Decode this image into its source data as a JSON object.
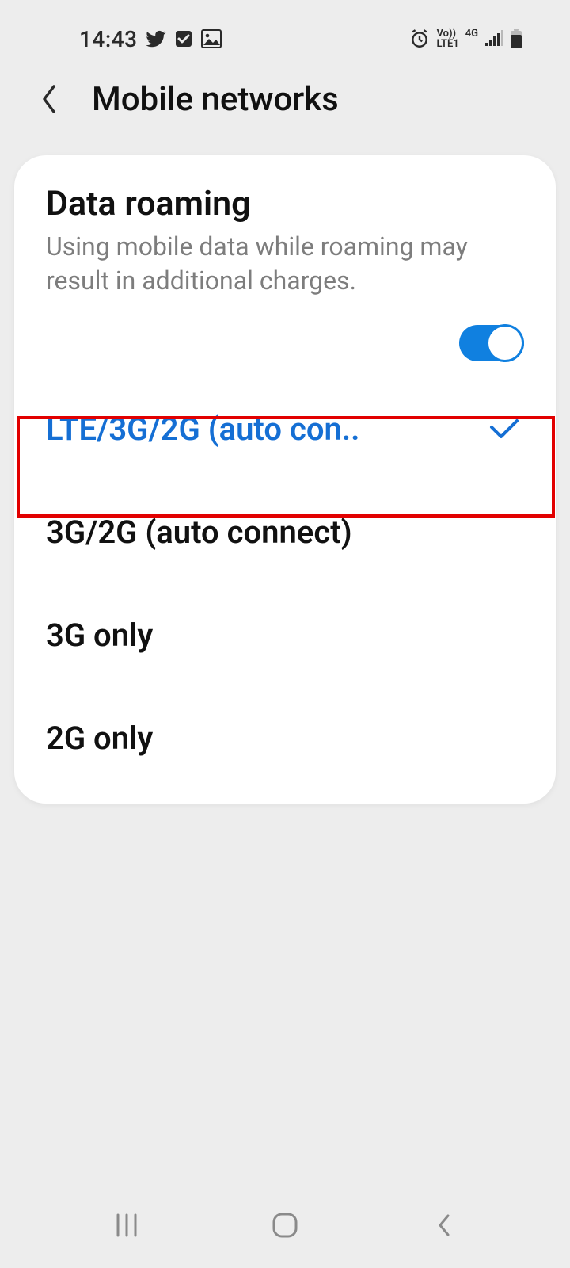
{
  "status": {
    "time": "14:43",
    "net_top": "Vo))",
    "net_bot": "LTE1",
    "net_gen": "4G"
  },
  "header": {
    "title": "Mobile networks"
  },
  "roaming": {
    "title": "Data roaming",
    "description": "Using mobile data while roaming may result in additional charges.",
    "enabled": true
  },
  "network_modes": {
    "selected_index": 0,
    "options": [
      {
        "label": "LTE/3G/2G (auto con.."
      },
      {
        "label": "3G/2G (auto connect)"
      },
      {
        "label": "3G only"
      },
      {
        "label": "2G only"
      }
    ]
  },
  "colors": {
    "accent": "#156fd4",
    "toggle": "#1080e0",
    "highlight": "#e20000"
  }
}
